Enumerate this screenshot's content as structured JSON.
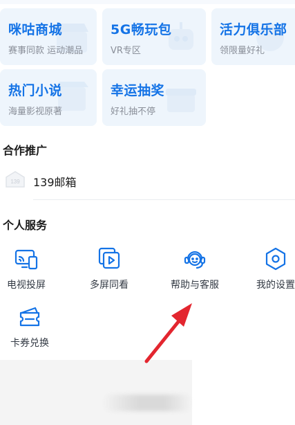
{
  "colors": {
    "accent": "#1473e6",
    "card_bg": "#eef5fc",
    "subtext": "#8a8f99",
    "annotation_arrow": "#e3262f"
  },
  "promo_cards": [
    {
      "title": "咪咕商城",
      "subtitle": "赛事同款 运动潮品"
    },
    {
      "title": "5G畅玩包",
      "subtitle": "VR专区"
    },
    {
      "title": "活力俱乐部",
      "subtitle": "领限量好礼"
    },
    {
      "title": "热门小说",
      "subtitle": "海量影视原著"
    },
    {
      "title": "幸运抽奖",
      "subtitle": "好礼抽不停"
    }
  ],
  "partner": {
    "section_title": "合作推广",
    "items": [
      {
        "label": "139邮箱",
        "icon": "mail-139-icon"
      }
    ]
  },
  "services": {
    "section_title": "个人服务",
    "items": [
      {
        "label": "电视投屏",
        "icon": "tv-cast-icon"
      },
      {
        "label": "多屏同看",
        "icon": "multi-screen-icon"
      },
      {
        "label": "帮助与客服",
        "icon": "customer-service-icon"
      },
      {
        "label": "我的设置",
        "icon": "settings-icon"
      },
      {
        "label": "卡券兑换",
        "icon": "coupon-icon"
      }
    ]
  }
}
